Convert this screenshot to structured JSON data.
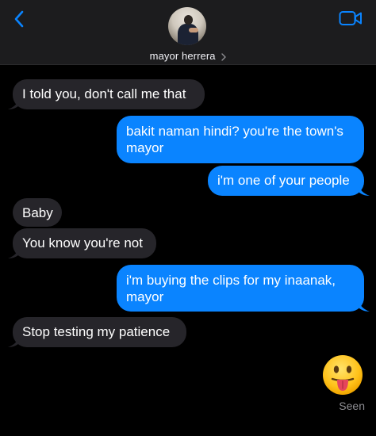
{
  "header": {
    "contact_name": "mayor herrera",
    "back_icon": "chevron-left-icon",
    "video_icon": "video-camera-icon",
    "accent_color": "#0a84ff"
  },
  "messages": [
    {
      "direction": "incoming",
      "text": "I told you, don't call me that"
    },
    {
      "direction": "outgoing",
      "line1": "bakit naman hindi? you're the town's",
      "line2": "mayor"
    },
    {
      "direction": "outgoing",
      "text": "i'm one of your people"
    },
    {
      "direction": "incoming",
      "text": "Baby"
    },
    {
      "direction": "incoming",
      "text": "You know you're not"
    },
    {
      "direction": "outgoing",
      "line1": "i'm buying the clips for my inaanak,",
      "line2": "mayor"
    },
    {
      "direction": "incoming",
      "text": "Stop testing my patience"
    },
    {
      "direction": "outgoing",
      "emoji": "😛"
    }
  ],
  "status": {
    "seen_label": "Seen"
  },
  "colors": {
    "incoming_bubble": "#26252a",
    "outgoing_bubble": "#0a84ff",
    "background": "#000000"
  }
}
